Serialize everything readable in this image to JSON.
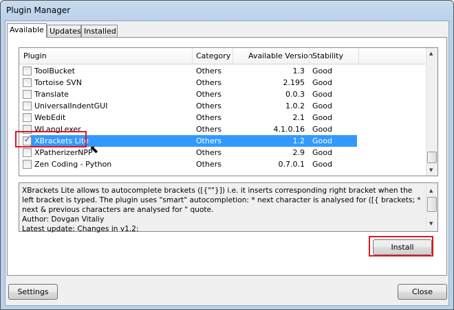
{
  "window": {
    "title": "Plugin Manager"
  },
  "tabs": [
    {
      "label": "Available"
    },
    {
      "label": "Updates"
    },
    {
      "label": "Installed"
    }
  ],
  "columns": [
    "Plugin",
    "Category",
    "Available Version",
    "Stability"
  ],
  "rows": [
    {
      "name": "ToolBucket",
      "category": "Others",
      "version": "1.3",
      "stability": "Good",
      "checked": false
    },
    {
      "name": "Tortoise SVN",
      "category": "Others",
      "version": "2.195",
      "stability": "Good",
      "checked": false
    },
    {
      "name": "Translate",
      "category": "Others",
      "version": "0.0.3",
      "stability": "Good",
      "checked": false
    },
    {
      "name": "UniversalIndentGUI",
      "category": "Others",
      "version": "1.0.2",
      "stability": "Good",
      "checked": false
    },
    {
      "name": "WebEdit",
      "category": "Others",
      "version": "2.1",
      "stability": "Good",
      "checked": false
    },
    {
      "name": "WLangLexer",
      "category": "Others",
      "version": "4.1.0.16",
      "stability": "Good",
      "checked": false
    },
    {
      "name": "XBrackets Lite",
      "category": "Others",
      "version": "1.2",
      "stability": "Good",
      "checked": true,
      "selected": true
    },
    {
      "name": "XPatherizerNPP",
      "category": "Others",
      "version": "2.9",
      "stability": "Good",
      "checked": false
    },
    {
      "name": "Zen Coding - Python",
      "category": "Others",
      "version": "0.7.0.1",
      "stability": "Good",
      "checked": false
    }
  ],
  "description": [
    "XBrackets Lite allows to autocomplete brackets ([{\"\"}]) i.e. it inserts corresponding right bracket when the left bracket is typed. The plugin uses \"smart\" autocompletion: * next character is analysed for ([{ brackets; * next & previous characters are analysed for \" quote.",
    "Author: Dovgan Vitaliy",
    "Latest update: Changes in v1.2:"
  ],
  "buttons": {
    "install": "Install",
    "settings": "Settings",
    "close": "Close"
  },
  "colors": {
    "selection": "#3399ff",
    "highlight": "#e0141e"
  }
}
